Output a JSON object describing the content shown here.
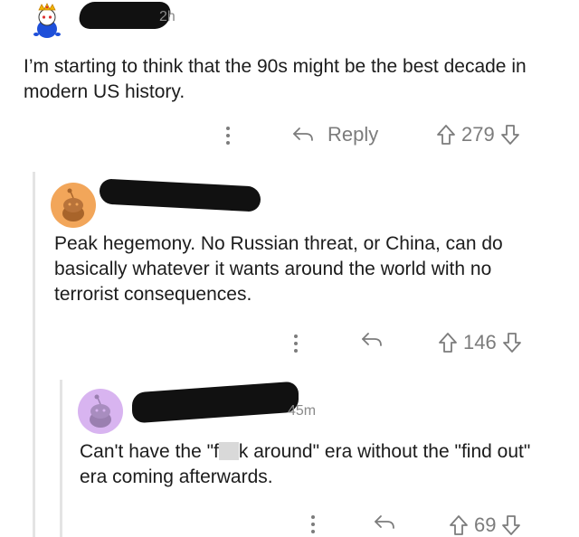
{
  "comments": [
    {
      "time": "2h",
      "text": "I’m starting to think that the 90s might be the best decade in modern US history.",
      "reply_label": "Reply",
      "votes": "279"
    },
    {
      "text": "Peak hegemony. No Russian threat, or China, can do basically whatever it wants around the world with no terrorist consequences.",
      "votes": "146"
    },
    {
      "time": "45m",
      "text_before": "Can't have the \"f",
      "text_after": "k around\" era without the \"find out\" era coming afterwards.",
      "votes": "69"
    }
  ],
  "colors": {
    "avatar1_bg": "#ffffff",
    "avatar2_bg": "#f2a65a",
    "avatar3_bg": "#d8b4f0",
    "redaction": "#111111"
  }
}
